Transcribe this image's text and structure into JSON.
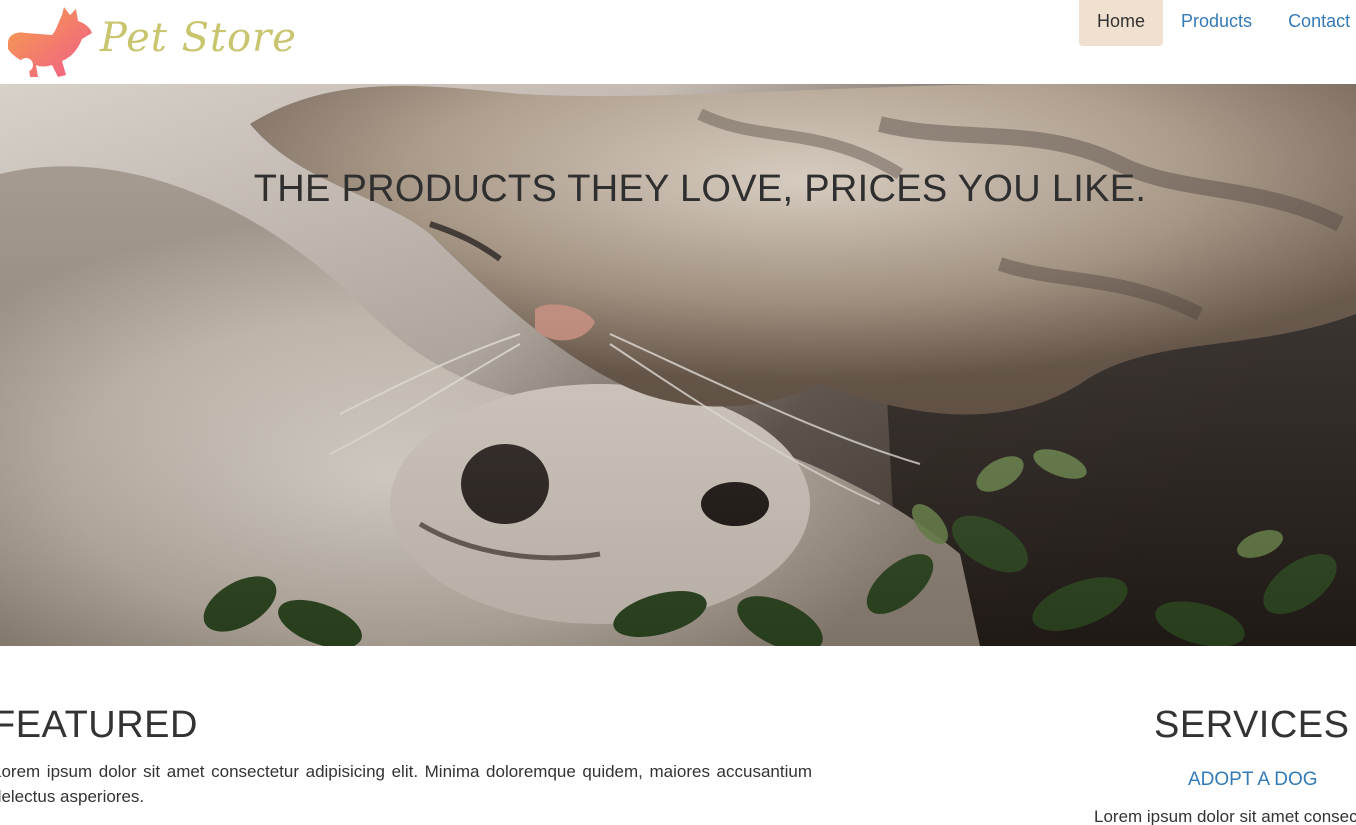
{
  "brand": {
    "name": "Pet Store",
    "logo_icon": "running-dog-icon",
    "logo_colors": [
      "#f6a14a",
      "#f05b8a"
    ],
    "name_color": "#c9c56f"
  },
  "nav": {
    "items": [
      {
        "label": "Home",
        "active": true
      },
      {
        "label": "Products",
        "active": false
      },
      {
        "label": "Contact",
        "active": false
      }
    ],
    "active_bg": "#f0e0d0",
    "link_color": "#337ab7"
  },
  "hero": {
    "title": "THE PRODUCTS THEY LOVE, PRICES YOU LIKE.",
    "image": "cat-and-dog-photo"
  },
  "featured": {
    "heading": "FEATURED",
    "text": "Lorem ipsum dolor sit amet consectetur adipisicing elit. Minima doloremque quidem, maiores accusantium delectus asperiores."
  },
  "services": {
    "heading": "SERVICES",
    "link": "ADOPT A DOG",
    "text": "Lorem ipsum dolor sit amet consectetur"
  }
}
